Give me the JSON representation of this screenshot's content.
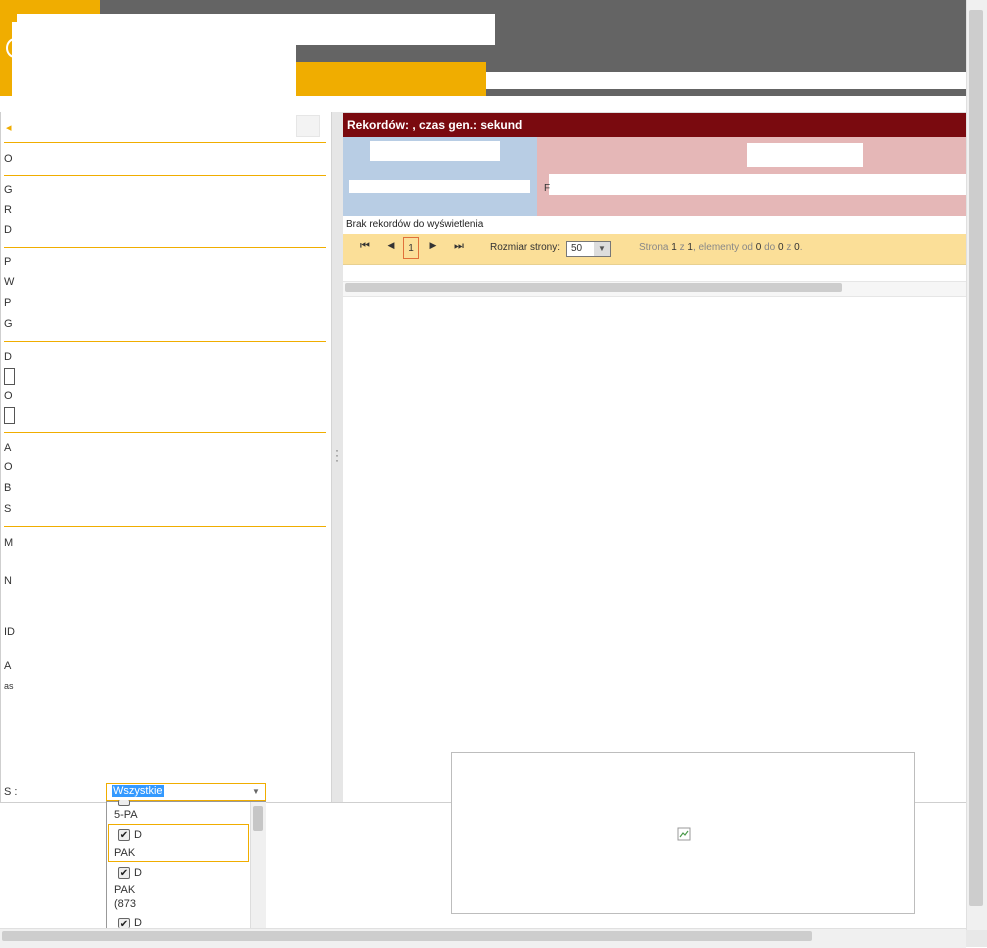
{
  "grid": {
    "records_header": "Rekordów: , czas gen.: sekund",
    "empty_message": "Brak rekordów do wyświetlenia",
    "pink_label": "F"
  },
  "pager": {
    "first_icon": "⏮",
    "prev_icon": "◀",
    "current_page": "1",
    "next_icon": "▶",
    "last_icon": "⏭",
    "page_size_label": "Rozmiar strony:",
    "page_size_value": "50",
    "info_prefix": "Strona",
    "info_page": "1",
    "info_of": "z",
    "info_total": "1",
    "info_items": ", elementy od",
    "info_from": "0",
    "info_to_word": "do",
    "info_to": "0",
    "info_of2": "z",
    "info_count": "0",
    "info_end": "."
  },
  "left_panel": {
    "labels": [
      "O",
      "G",
      "R",
      "D",
      "P",
      "W",
      "P",
      "G",
      "D",
      "O",
      "A",
      "O",
      "B",
      "S",
      "M",
      "N",
      "ID",
      "A",
      "as"
    ],
    "status_label": "S  :",
    "status_value": "Wszystkie"
  },
  "dropdown": {
    "items": [
      {
        "line1": "5-PA",
        "checked": true
      },
      {
        "line1": "PAK",
        "checked": true
      },
      {
        "line1": "PAK",
        "line2": "(873",
        "checked": true
      }
    ],
    "check_char": "✔",
    "partial_char": "D"
  },
  "colors": {
    "brand_yellow": "#f0ad00",
    "header_gray": "#646464",
    "records_bar": "#7a0a0f",
    "blue_panel": "#b8cde4",
    "pink_panel": "#e5b7b7",
    "pager_bg": "#fbdf98"
  }
}
